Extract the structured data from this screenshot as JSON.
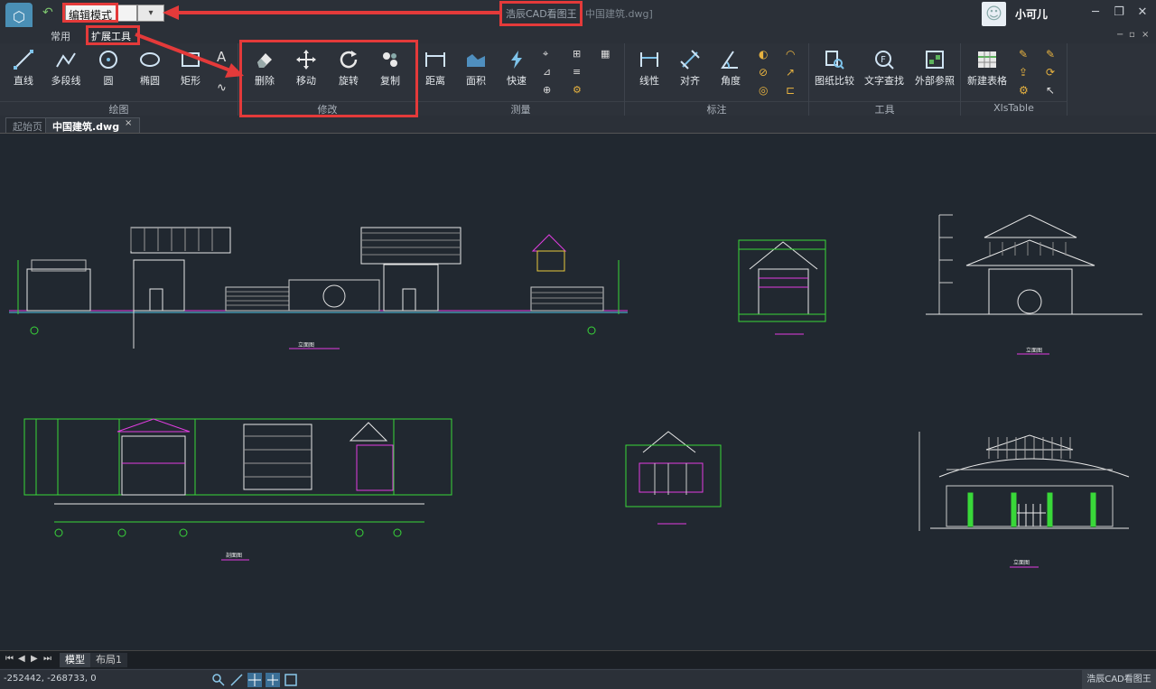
{
  "app": {
    "name": "浩辰CAD看图王",
    "file": "中国建筑.dwg]",
    "mode": "编辑模式",
    "user": "小可儿",
    "brand": "浩辰CAD看图王"
  },
  "tabs": [
    "常用",
    "扩展工具"
  ],
  "groups": {
    "draw": "绘图",
    "modify": "修改",
    "measure": "测量",
    "annotate": "标注",
    "tools": "工具",
    "xls": "XlsTable"
  },
  "draw_tools": [
    "直线",
    "多段线",
    "圆",
    "椭圆",
    "矩形"
  ],
  "modify_tools": [
    "删除",
    "移动",
    "旋转",
    "复制"
  ],
  "measure_tools": [
    "距离",
    "面积",
    "快速"
  ],
  "annotate_tools": [
    "线性",
    "对齐",
    "角度"
  ],
  "tools_tools": [
    "图纸比较",
    "文字查找",
    "外部参照"
  ],
  "xls_tools": [
    "新建表格"
  ],
  "docs": [
    "起始页",
    "中国建筑.dwg"
  ],
  "layouts": [
    "模型",
    "布局1"
  ],
  "coords": "-252442, -268733, 0",
  "drawing_labels": [
    "立面图",
    "立面图",
    "剖面图",
    "立面图"
  ],
  "colors": {
    "highlight": "#e43a3a",
    "background": "#212830",
    "ribbon": "#2d323a"
  }
}
